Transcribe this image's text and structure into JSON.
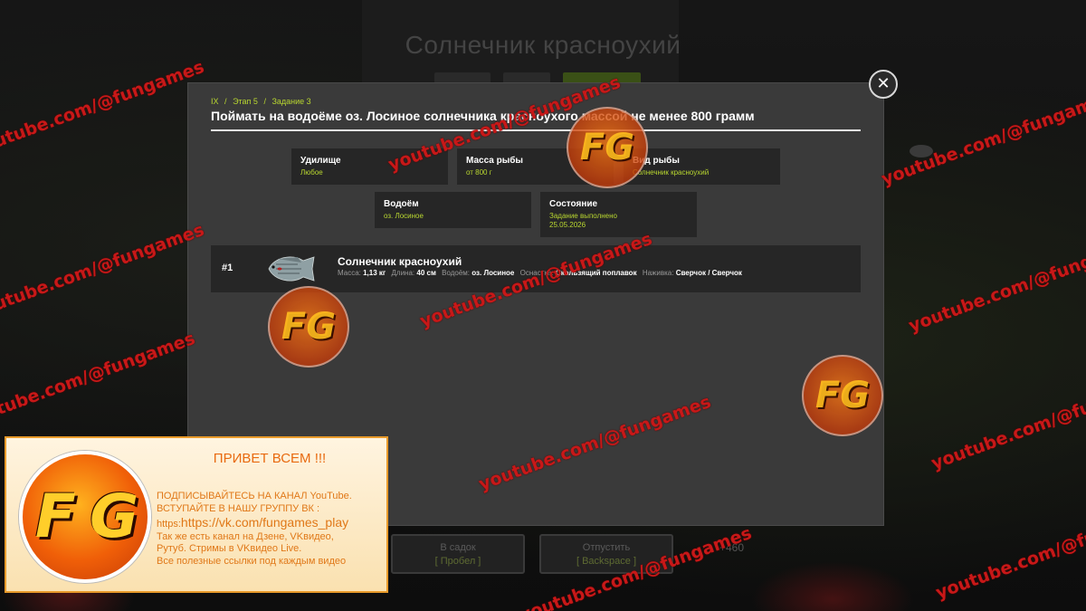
{
  "background": {
    "title": "Солнечник красноухий",
    "buttons": [
      {
        "label": "В садок",
        "sub": "[ Пробел ]"
      },
      {
        "label": "Отпустить",
        "sub": "[ Backspace ]"
      }
    ],
    "price": "+460"
  },
  "modal": {
    "breadcrumb": [
      "IX",
      "/",
      "Этап 5",
      "/",
      "Задание 3"
    ],
    "title": "Поймать на водоёме оз. Лосиное солнечника красноухого массой не менее 800 грамм",
    "close_icon": "close-icon",
    "info": [
      {
        "label": "Удилище",
        "value": "Любое"
      },
      {
        "label": "Масса рыбы",
        "value": "от 800 г"
      },
      {
        "label": "Вид рыбы",
        "value": "Солнечник красноухий"
      },
      {
        "label": "Водоём",
        "value": "оз. Лосиное"
      },
      {
        "label": "Состояние",
        "value": "Задание выполнено",
        "value2": "25.05.2026"
      }
    ],
    "catch": {
      "num": "#1",
      "fish_icon": "fish-icon",
      "name": "Солнечник красноухий",
      "meta": [
        {
          "k": "Масса:",
          "v": "1,13 кг"
        },
        {
          "k": "Длина:",
          "v": "40 см"
        },
        {
          "k": "Водоём:",
          "v": "оз. Лосиное"
        },
        {
          "k": "Оснастка:",
          "v": "Скользящий поплавок"
        },
        {
          "k": "Наживка:",
          "v": "Сверчок / Сверчок"
        }
      ]
    }
  },
  "watermark": {
    "text": "youtube.com/@fungames",
    "badge": "FG"
  },
  "promo": {
    "logo": "F G",
    "heading": "ПРИВЕТ ВСЕМ !!!",
    "lines": [
      "ПОДПИСЫВАЙТЕСЬ НА КАНАЛ YouTube.",
      "ВСТУПАЙТЕ В НАШУ ГРУППУ ВК :"
    ],
    "link_prefix": "https:",
    "link": "https://vk.com/fungames_play",
    "lines2": [
      "Так же есть канал на Дзене, VKвидео,",
      "Рутуб. Стримы в VKвидео Live.",
      "Все полезные ссылки под каждым видео"
    ]
  },
  "colors": {
    "accent_green": "#b8d630",
    "watermark_red": "#c81818",
    "promo_orange": "#e07818"
  }
}
